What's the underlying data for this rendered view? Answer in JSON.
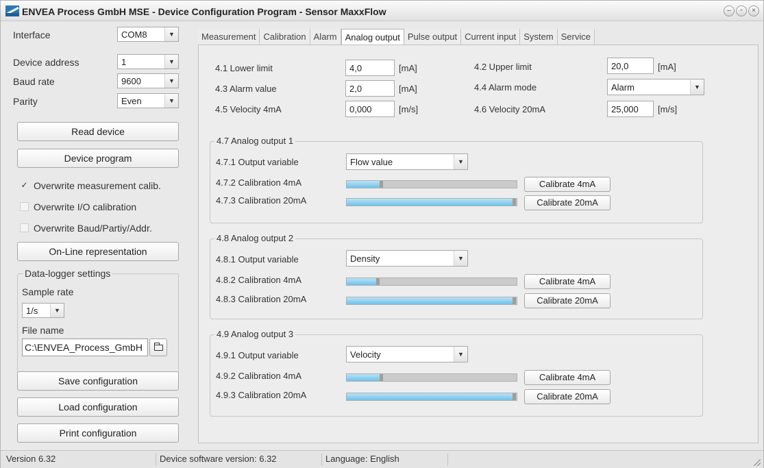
{
  "window": {
    "title": "ENVEA Process GmbH MSE - Device Configuration Program - Sensor MaxxFlow",
    "controls": [
      "–",
      "▫",
      "×"
    ]
  },
  "sidebar": {
    "interface_label": "Interface",
    "interface_value": "COM8",
    "address_label": "Device address",
    "address_value": "1",
    "baud_label": "Baud rate",
    "baud_value": "9600",
    "parity_label": "Parity",
    "parity_value": "Even",
    "read_device": "Read device",
    "device_program": "Device program",
    "chk_measurement": "Overwrite measurement calib.",
    "chk_io": "Overwrite I/O calibration",
    "chk_baud": "Overwrite Baud/Partiy/Addr.",
    "online": "On-Line representation",
    "datalogger_title": "Data-logger settings",
    "sample_rate_label": "Sample rate",
    "sample_rate_value": "1/s",
    "file_name_label": "File name",
    "file_name_value": "C:\\ENVEA_Process_GmbH",
    "save_config": "Save configuration",
    "load_config": "Load configuration",
    "print_config": "Print configuration"
  },
  "tabs": [
    "Measurement",
    "Calibration",
    "Alarm",
    "Analog output",
    "Pulse output",
    "Current input",
    "System",
    "Service"
  ],
  "active_tab": "Analog output",
  "analog": {
    "lower_limit_label": "4.1 Lower limit",
    "lower_limit_value": "4,0",
    "lower_limit_unit": "[mA]",
    "upper_limit_label": "4.2 Upper limit",
    "upper_limit_value": "20,0",
    "upper_limit_unit": "[mA]",
    "alarm_value_label": "4.3 Alarm value",
    "alarm_value_value": "2,0",
    "alarm_value_unit": "[mA]",
    "alarm_mode_label": "4.4 Alarm mode",
    "alarm_mode_value": "Alarm",
    "vel4_label": "4.5 Velocity 4mA",
    "vel4_value": "0,000",
    "vel4_unit": "[m/s]",
    "vel20_label": "4.6 Velocity 20mA",
    "vel20_value": "25,000",
    "vel20_unit": "[m/s]",
    "outputs": [
      {
        "title": "4.7 Analog output 1",
        "var_label": "4.7.1 Output variable",
        "var_value": "Flow value",
        "cal4_label": "4.7.2 Calibration 4mA",
        "cal4_level": 0.2,
        "cal20_label": "4.7.3 Calibration 20mA",
        "cal20_level": 1.0,
        "btn4": "Calibrate 4mA",
        "btn20": "Calibrate 20mA"
      },
      {
        "title": "4.8 Analog output 2",
        "var_label": "4.8.1 Output variable",
        "var_value": "Density",
        "cal4_label": "4.8.2 Calibration 4mA",
        "cal4_level": 0.18,
        "cal20_label": "4.8.3 Calibration 20mA",
        "cal20_level": 1.0,
        "btn4": "Calibrate 4mA",
        "btn20": "Calibrate 20mA"
      },
      {
        "title": "4.9 Analog output 3",
        "var_label": "4.9.1 Output variable",
        "var_value": "Velocity",
        "cal4_label": "4.9.2 Calibration 4mA",
        "cal4_level": 0.2,
        "cal20_label": "4.9.3 Calibration 20mA",
        "cal20_level": 1.0,
        "btn4": "Calibrate 4mA",
        "btn20": "Calibrate 20mA"
      }
    ]
  },
  "status": {
    "version": "Version 6.32",
    "device_sw": "Device software version: 6.32",
    "language": "Language: English"
  },
  "icons": {
    "logo": "envea-logo-icon",
    "dropdown": "chevron-down-icon",
    "folder": "folder-open-icon",
    "checkmark": "checkmark-icon"
  },
  "colors": {
    "progress_fill": "#70c2ea",
    "logo_blue": "#2a78b8"
  }
}
